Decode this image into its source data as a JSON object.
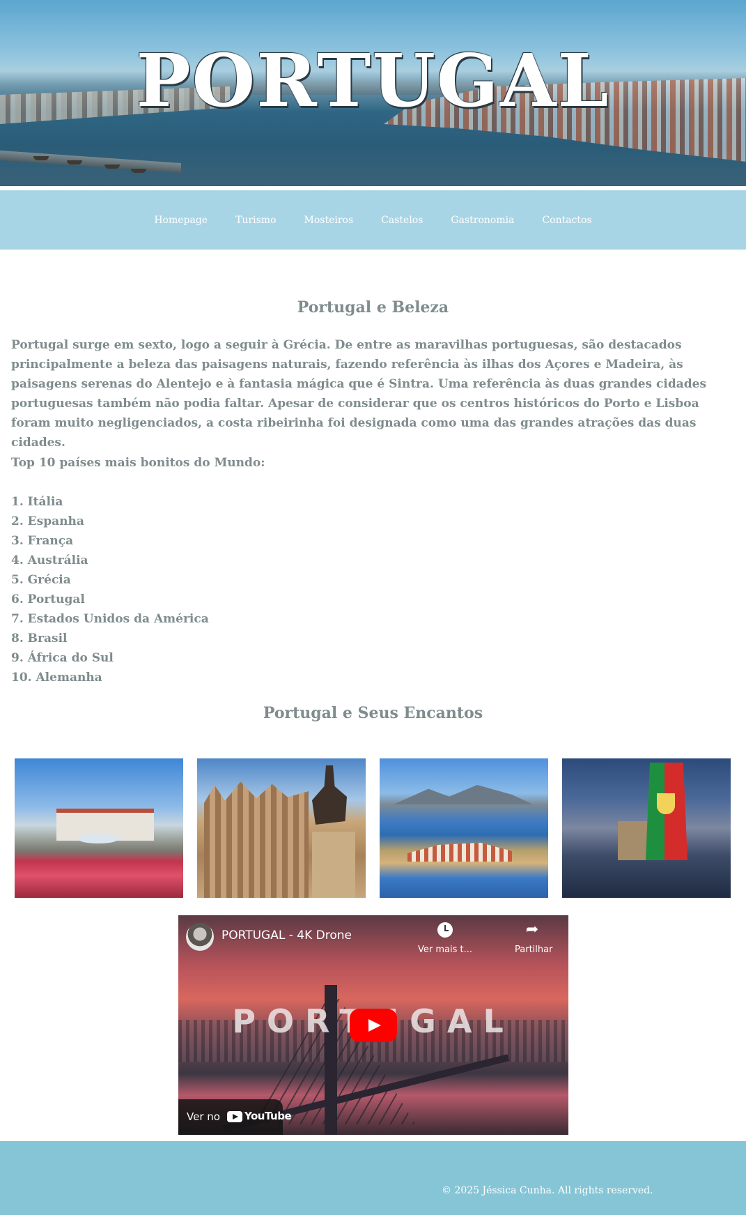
{
  "hero": {
    "title": "PORTUGAL"
  },
  "nav": {
    "items": [
      {
        "label": "Homepage"
      },
      {
        "label": "Turismo"
      },
      {
        "label": "Mosteiros"
      },
      {
        "label": "Castelos"
      },
      {
        "label": "Gastronomia"
      },
      {
        "label": "Contactos"
      }
    ]
  },
  "main": {
    "heading1": "Portugal e Beleza",
    "intro": "Portugal surge em sexto, logo a seguir à Grécia. De entre as maravilhas portuguesas, são destacados principalmente a beleza das paisagens naturais, fazendo referência às ilhas dos Açores e Madeira, às paisagens serenas do Alentejo e à fantasia mágica que é Sintra. Uma referência às duas grandes cidades portuguesas também não podia faltar. Apesar de considerar que os centros históricos do Porto e Lisboa foram muito negligenciados, a costa ribeirinha foi designada como uma das grandes atrações das duas cidades.",
    "list_label": "Top 10 países mais bonitos do Mundo:",
    "countries": [
      "1. Itália",
      "2. Espanha",
      "3. França",
      "4. Austrália",
      "5. Grécia",
      "6. Portugal",
      "7. Estados Unidos da América",
      "8. Brasil",
      "9. África do Sul",
      "10. Alemanha"
    ],
    "heading2": "Portugal e Seus Encantos"
  },
  "video": {
    "title": "PORTUGAL - 4K Drone",
    "overlay_text": "PORTUGAL",
    "watch_later": "Ver mais t...",
    "share": "Partilhar",
    "watch_on": "Ver no",
    "platform": "YouTube"
  },
  "footer": {
    "copyright": "© 2025 Jéssica Cunha. All rights reserved."
  },
  "colors": {
    "nav_bg": "#a8d5e5",
    "footer_bg": "#85c5d6",
    "text": "#7f8c8d",
    "play_button": "#ff0000"
  }
}
